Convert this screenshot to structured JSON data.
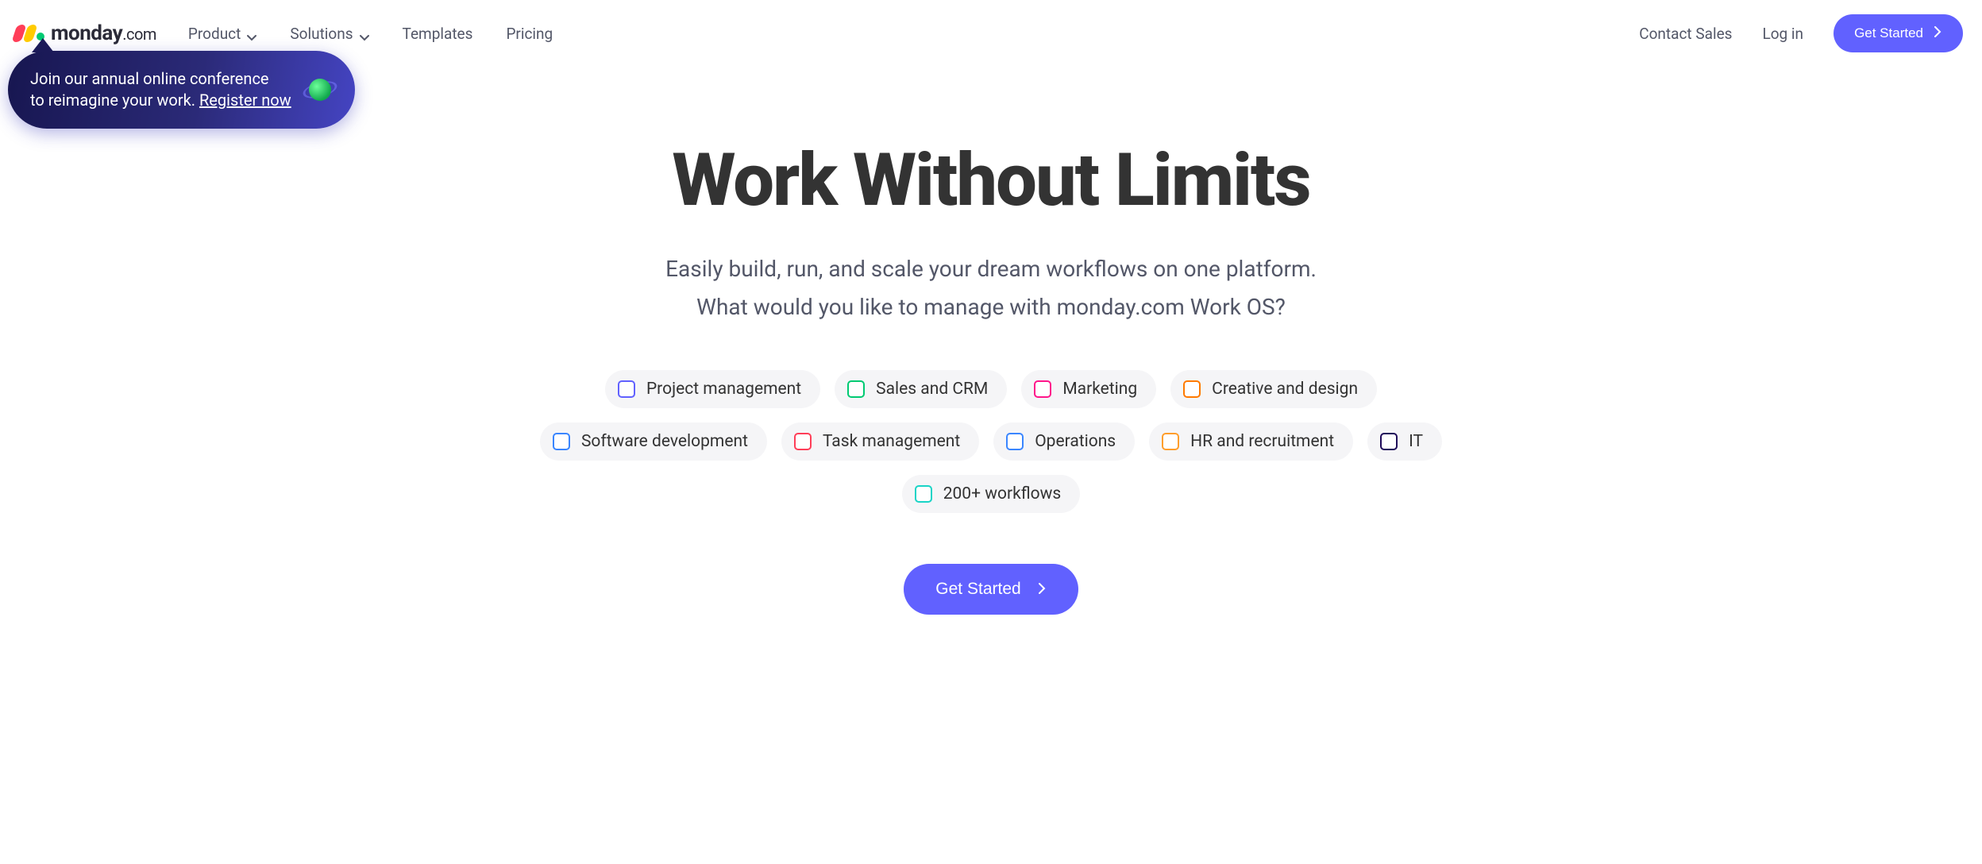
{
  "brand": {
    "name": "monday",
    "ext": ".com"
  },
  "nav": {
    "product": "Product",
    "solutions": "Solutions",
    "templates": "Templates",
    "pricing": "Pricing",
    "contact": "Contact Sales",
    "login": "Log in",
    "cta": "Get Started"
  },
  "promo": {
    "line1": "Join our annual online conference",
    "line2_prefix": "to reimagine your work. ",
    "register": "Register now"
  },
  "hero": {
    "title": "Work Without Limits",
    "sub1": "Easily build, run, and scale your dream workflows on one platform.",
    "sub2": "What would you like to manage with monday.com Work OS?"
  },
  "categories": [
    {
      "label": "Project management",
      "color": "#6161ff"
    },
    {
      "label": "Sales and CRM",
      "color": "#00ca72"
    },
    {
      "label": "Marketing",
      "color": "#ff158a"
    },
    {
      "label": "Creative and design",
      "color": "#ff7a00"
    },
    {
      "label": "Software development",
      "color": "#3a86ff"
    },
    {
      "label": "Task management",
      "color": "#ff3e58"
    },
    {
      "label": "Operations",
      "color": "#3a86ff"
    },
    {
      "label": "HR and recruitment",
      "color": "#ff9e2c"
    },
    {
      "label": "IT",
      "color": "#1f0a5a"
    },
    {
      "label": "200+ workflows",
      "color": "#19d4c6"
    }
  ],
  "cta": {
    "label": "Get Started"
  }
}
